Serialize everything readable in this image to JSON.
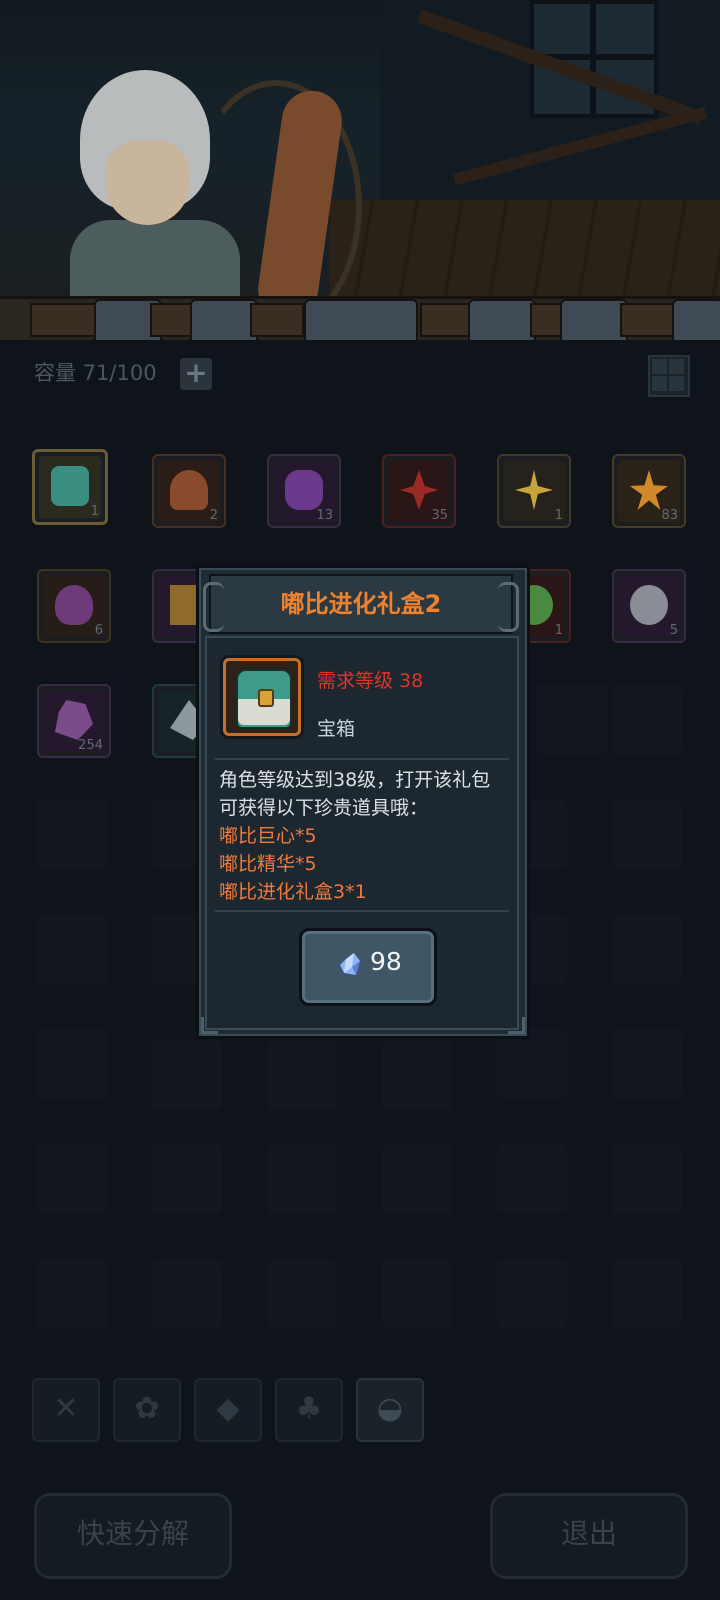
{
  "inventory": {
    "capacity_label": "容量 71/100",
    "expand_icon": "plus-icon",
    "view_toggle_icon": "grid-icon",
    "items": [
      {
        "icon": "treasure-chest-icon",
        "count": "1",
        "color": "#3a8f80",
        "selected": true
      },
      {
        "icon": "mushroom-icon",
        "count": "2",
        "color": "#8a4a2e"
      },
      {
        "icon": "purple-stone-icon",
        "count": "13",
        "color": "#6b3a8c"
      },
      {
        "icon": "red-crystal-icon",
        "count": "35",
        "color": "#9c2a24"
      },
      {
        "icon": "star-spike-icon",
        "count": "1",
        "color": "#c8a53a"
      },
      {
        "icon": "orange-star-icon",
        "count": "83",
        "color": "#d2892c"
      },
      {
        "icon": "purple-flame-icon",
        "count": "6",
        "color": "#6e3b7a"
      },
      {
        "icon": "gold-item-icon",
        "count": "",
        "color": "#8f6b2b"
      },
      {
        "icon": "watermelon-icon",
        "count": "1",
        "color": "#4a8a3e"
      },
      {
        "icon": "gear-stone-icon",
        "count": "5",
        "color": "#8a8d96"
      },
      {
        "icon": "purple-ore-icon",
        "count": "254",
        "color": "#7a4c8a"
      },
      {
        "icon": "grey-crystal-icon",
        "count": "",
        "color": "#8d979e"
      }
    ]
  },
  "tabs": [
    {
      "icon": "tools-icon"
    },
    {
      "icon": "paw-icon"
    },
    {
      "icon": "gem-icon"
    },
    {
      "icon": "leaf-icon"
    },
    {
      "icon": "chest-icon"
    }
  ],
  "buttons": {
    "quick_decompose": "快速分解",
    "exit": "退出"
  },
  "popup": {
    "title": "嘟比进化礼盒2",
    "icon": "treasure-chest-icon",
    "requirement": "需求等级 38",
    "type": "宝箱",
    "description_lines": [
      "角色等级达到38级，打开该礼包",
      "可获得以下珍贵道具哦："
    ],
    "reward_lines": [
      "嘟比巨心*5",
      "嘟比精华*5",
      "嘟比进化礼盒3*1"
    ],
    "price_icon": "crystal-icon",
    "price": "98"
  },
  "colors": {
    "title_orange": "#f0822d",
    "requirement_red": "#e0342b",
    "reward_orange": "#ef7a3a"
  }
}
